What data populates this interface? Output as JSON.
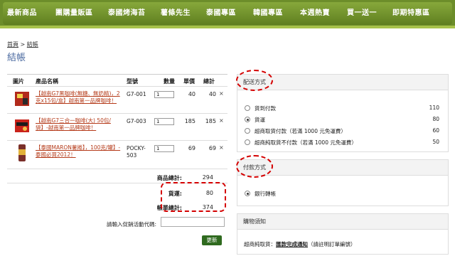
{
  "nav": [
    "最新商品",
    "團購量販區",
    "泰國烤海苔",
    "薯條先生",
    "泰國專區",
    "韓國專區",
    "本週熱賣",
    "買一送一",
    "即期特惠區"
  ],
  "breadcrumb": {
    "home": "首頁",
    "sep": ">",
    "current": "結帳"
  },
  "page_title": "結帳",
  "cart": {
    "headers": {
      "image": "圖片",
      "name": "產品名稱",
      "model": "型號",
      "qty": "數量",
      "price": "單價",
      "subtotal": "總計"
    },
    "rows": [
      {
        "name": "【越南G7黑咖啡(無糖、無奶精)，2克x15包/盒】越南第一品牌咖啡！",
        "model": "G7-001",
        "qty": "1",
        "price": "40",
        "subtotal": "40"
      },
      {
        "name": "【越南G7三合一咖啡(大) 50包/袋】-越南第一品牌咖啡！",
        "model": "G7-003",
        "qty": "1",
        "price": "185",
        "subtotal": "185"
      },
      {
        "name": "【泰國MARON薯捲】，100克/罐】-泰國必買2012！",
        "model": "POCKY-503",
        "qty": "1",
        "price": "69",
        "subtotal": "69"
      }
    ],
    "delete_glyph": "×",
    "product_total_label": "商品總計:",
    "product_total": "294",
    "shipping_label": "貨運:",
    "shipping": "80",
    "order_total_label": "帳單總計:",
    "order_total": "374",
    "promo_label": "請輸入促銷活動代碼:",
    "update_button": "更新"
  },
  "shipping_panel": {
    "title": "配送方式",
    "options": [
      {
        "label": "貨到付款",
        "fee": "110",
        "selected": false
      },
      {
        "label": "貨運",
        "fee": "80",
        "selected": true
      },
      {
        "label": "超商取貨付款（若滿 1000 元免運費）",
        "fee": "60",
        "selected": false
      },
      {
        "label": "超商純取貨不付款（若滿 1000 元免運費）",
        "fee": "50",
        "selected": false
      }
    ]
  },
  "payment_panel": {
    "title": "付款方式",
    "options": [
      {
        "label": "銀行轉帳",
        "selected": true
      }
    ]
  },
  "notice_panel": {
    "title": "購物須知",
    "text_prefix": "超商純取貨：",
    "text_link": "匯款完成通知",
    "text_suffix": "（請註明訂單編號）"
  },
  "colors": {
    "nav_green": "#6c8d2a",
    "accent_red": "#d40000",
    "button_green": "#2f6a1f"
  }
}
